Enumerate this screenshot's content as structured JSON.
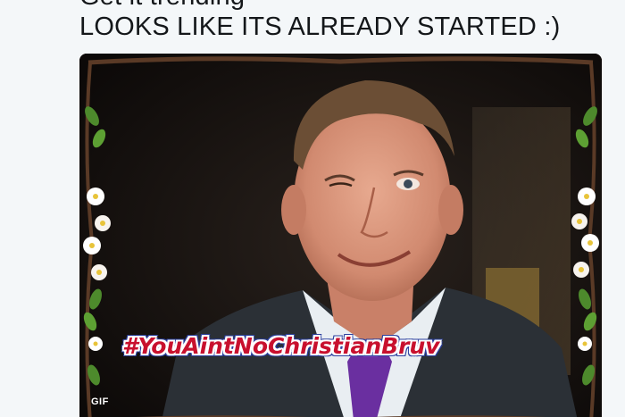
{
  "tweet": {
    "line_1": "Get it trending",
    "line_2": "LOOKS LIKE ITS ALREADY STARTED :)"
  },
  "media": {
    "hashtag": "#YouAintNoChristianBruv",
    "badge": "GIF",
    "icons": [
      "flower-garland-frame",
      "winking-man-portrait"
    ],
    "colors": {
      "hashtag_fill": "#c8102e",
      "hashtag_outline": "#2a3f9e",
      "background": "#120d0c",
      "suit": "#2b3036",
      "tie": "#6a2fa0"
    }
  }
}
